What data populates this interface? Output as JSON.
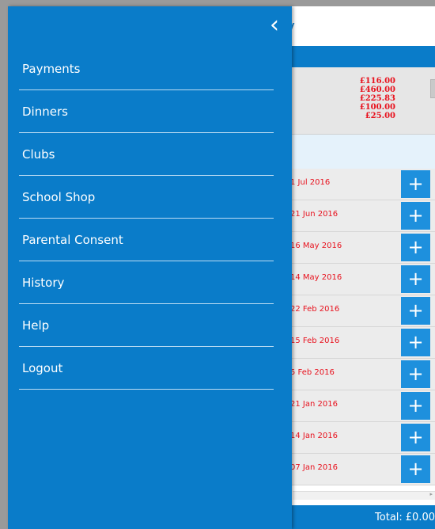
{
  "header": {
    "title_fragment": "y"
  },
  "totals": {
    "amounts": [
      "£116.00",
      "£460.00",
      "£225.83",
      "£100.00",
      "£25.00"
    ]
  },
  "rows": [
    {
      "date": "1 Jul 2016"
    },
    {
      "date": "21 Jun 2016"
    },
    {
      "date": "16 May 2016"
    },
    {
      "date": "14 May 2016"
    },
    {
      "date": "22 Feb 2016"
    },
    {
      "date": "15 Feb 2016"
    },
    {
      "date": "5 Feb 2016"
    },
    {
      "date": "21 Jan 2016"
    },
    {
      "date": "14 Jan 2016"
    },
    {
      "date": "07 Jan 2016"
    }
  ],
  "row_action_icon": "+",
  "footer": {
    "total_label": "Total:",
    "total_value": "£0.00"
  },
  "drawer": {
    "back_icon": "‹",
    "items": [
      {
        "label": "Payments"
      },
      {
        "label": "Dinners"
      },
      {
        "label": "Clubs"
      },
      {
        "label": "School Shop"
      },
      {
        "label": "Parental Consent"
      },
      {
        "label": "History"
      },
      {
        "label": "Help"
      },
      {
        "label": "Logout"
      }
    ]
  },
  "colors": {
    "brand_blue": "#0a7cc9",
    "amount_red": "#e8111d",
    "button_blue": "#1e90dd"
  }
}
